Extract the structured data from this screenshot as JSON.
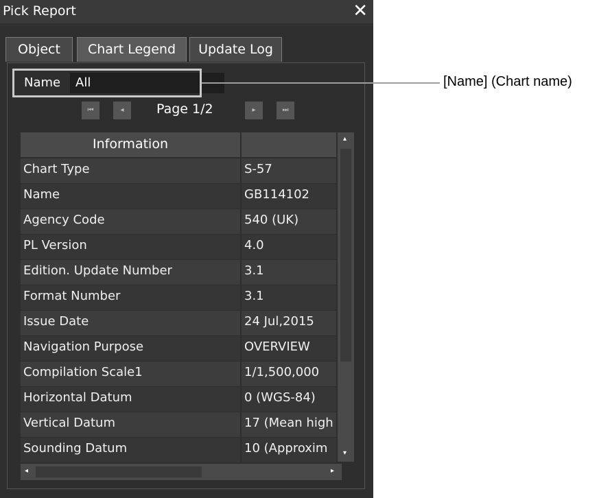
{
  "window": {
    "title": "Pick Report",
    "close_glyph": "✕"
  },
  "tabs": [
    {
      "label": "Object",
      "active": false
    },
    {
      "label": "Chart Legend",
      "active": true
    },
    {
      "label": "Update Log",
      "active": false
    }
  ],
  "name_field": {
    "label": "Name",
    "value": "All"
  },
  "pager": {
    "text": "Page 1/2",
    "first": "⏮",
    "prev": "◂",
    "next": "▸",
    "last": "⏭"
  },
  "table": {
    "headers": [
      "Information",
      ""
    ],
    "rows": [
      [
        "Chart Type",
        "S-57"
      ],
      [
        "Name",
        "GB114102"
      ],
      [
        "Agency Code",
        "540 (UK)"
      ],
      [
        "PL Version",
        "4.0"
      ],
      [
        "Edition. Update Number",
        "3.1"
      ],
      [
        "Format Number",
        "3.1"
      ],
      [
        "Issue Date",
        "24 Jul,2015"
      ],
      [
        "Navigation Purpose",
        "OVERVIEW"
      ],
      [
        "Compilation Scale1",
        "1/1,500,000"
      ],
      [
        "Horizontal Datum",
        "0 (WGS-84)"
      ],
      [
        "Vertical Datum",
        "17 (Mean high"
      ],
      [
        "Sounding Datum",
        "10 (Approxim"
      ]
    ]
  },
  "callout": {
    "text": "[Name]  (Chart name)"
  },
  "colors": {
    "panel_bg": "#2f2f2f",
    "header_bg": "#4a4a4a",
    "highlight": "#c9c9c9"
  }
}
